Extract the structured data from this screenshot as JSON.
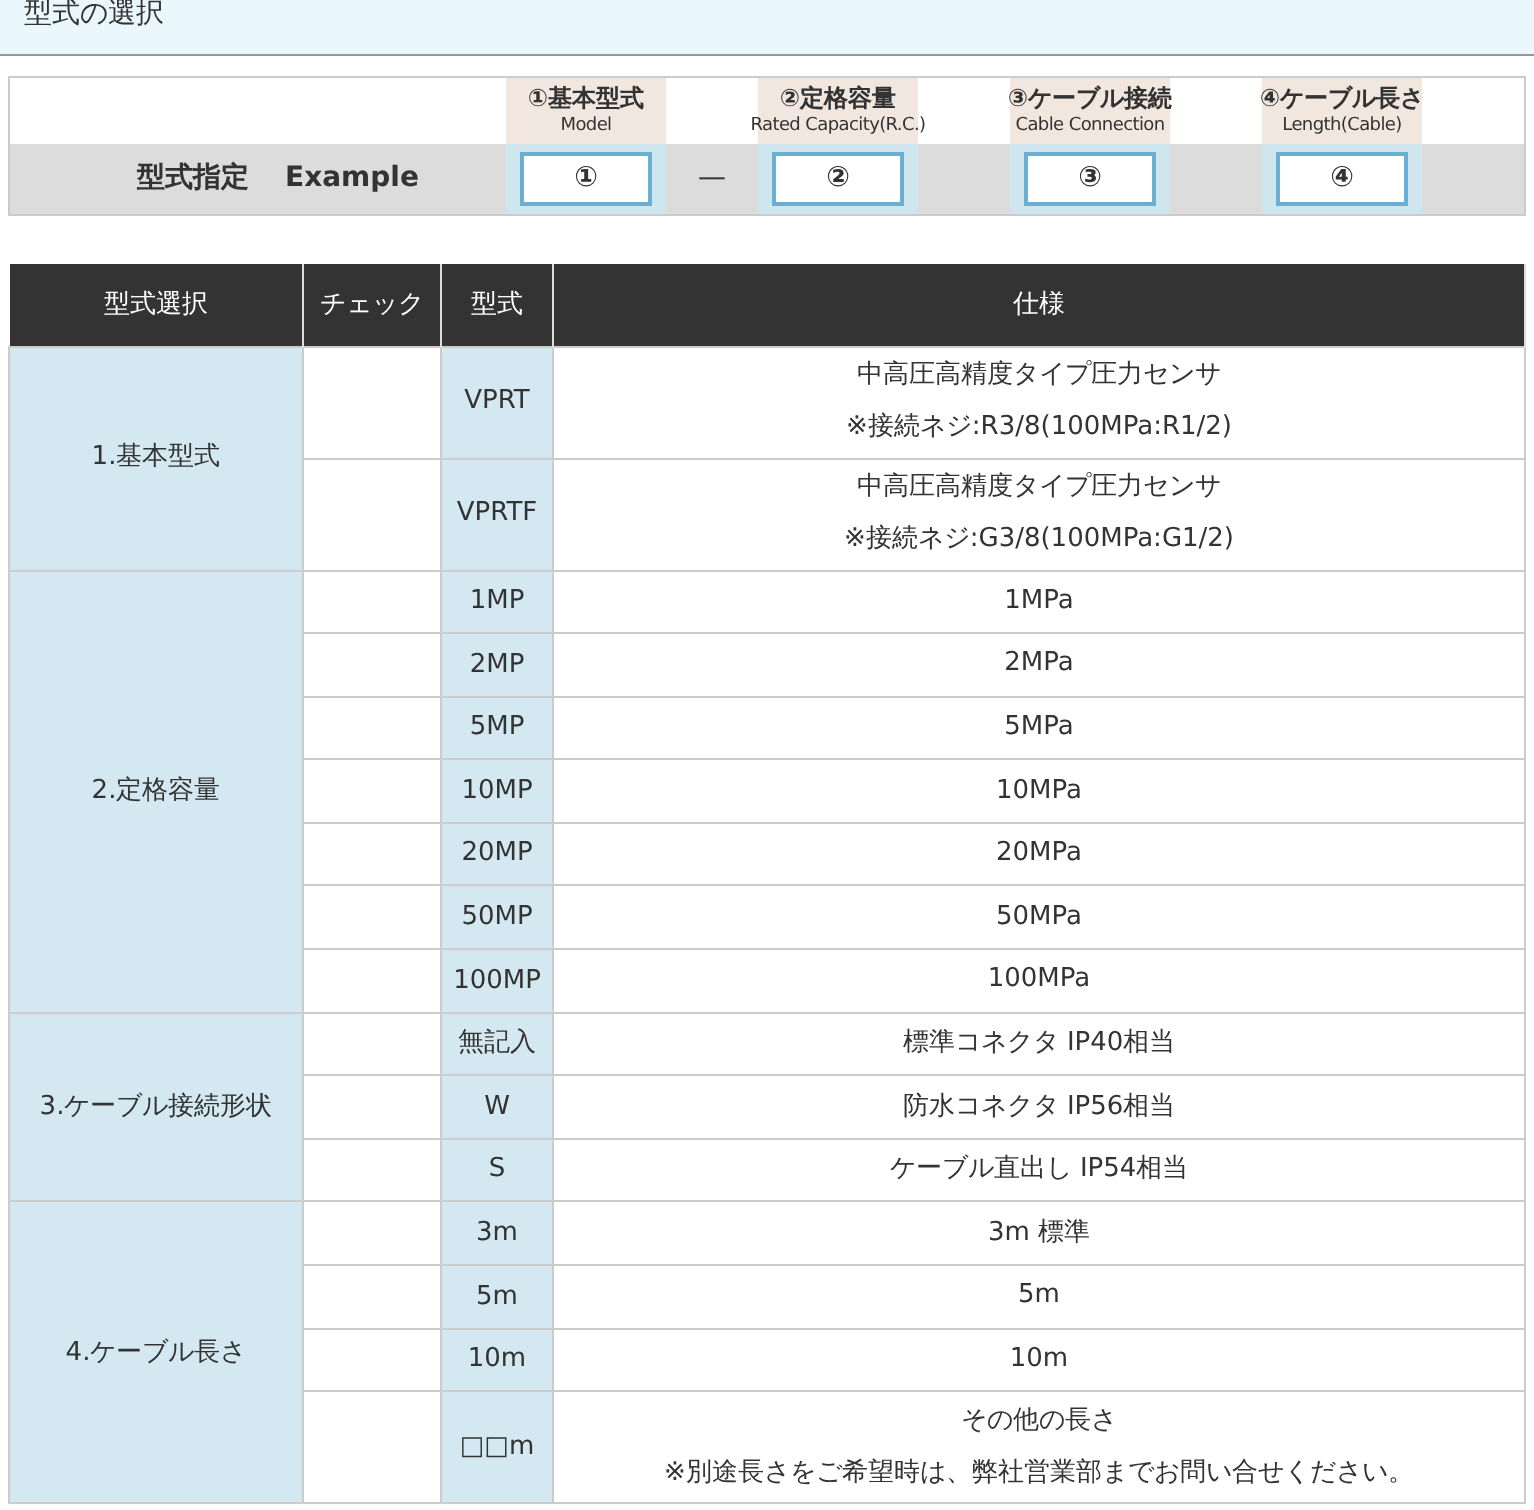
{
  "heading": "型式の選択",
  "example": {
    "label": "型式指定",
    "label_en": "Example",
    "items": [
      {
        "title": "①基本型式",
        "subtitle": "Model",
        "value": "①",
        "separator": "—"
      },
      {
        "title": "②定格容量",
        "subtitle": "Rated Capacity(R.C.)",
        "value": "②"
      },
      {
        "title": "③ケーブル接続",
        "subtitle": "Cable Connection",
        "value": "③"
      },
      {
        "title": "④ケーブル長さ",
        "subtitle": "Length(Cable)",
        "value": "④"
      }
    ]
  },
  "table": {
    "columns": [
      "型式選択",
      "チェック",
      "型式",
      "仕様"
    ],
    "groups": [
      {
        "label": "1.基本型式",
        "options": [
          {
            "model": "VPRT",
            "spec": [
              "中高圧高精度タイプ圧力センサ",
              "※接続ネジ:R3/8(100MPa:R1/2)"
            ]
          },
          {
            "model": "VPRTF",
            "spec": [
              "中高圧高精度タイプ圧力センサ",
              "※接続ネジ:G3/8(100MPa:G1/2)"
            ]
          }
        ]
      },
      {
        "label": "2.定格容量",
        "options": [
          {
            "model": "1MP",
            "spec": [
              "1MPa"
            ]
          },
          {
            "model": "2MP",
            "spec": [
              "2MPa"
            ]
          },
          {
            "model": "5MP",
            "spec": [
              "5MPa"
            ]
          },
          {
            "model": "10MP",
            "spec": [
              "10MPa"
            ]
          },
          {
            "model": "20MP",
            "spec": [
              "20MPa"
            ]
          },
          {
            "model": "50MP",
            "spec": [
              "50MPa"
            ]
          },
          {
            "model": "100MP",
            "spec": [
              "100MPa"
            ]
          }
        ]
      },
      {
        "label": "3.ケーブル接続形状",
        "options": [
          {
            "model": "無記入",
            "spec": [
              "標準コネクタ IP40相当"
            ]
          },
          {
            "model": "W",
            "spec": [
              "防水コネクタ IP56相当"
            ]
          },
          {
            "model": "S",
            "spec": [
              "ケーブル直出し IP54相当"
            ]
          }
        ]
      },
      {
        "label": "4.ケーブル長さ",
        "options": [
          {
            "model": "3m",
            "spec": [
              "3m 標準"
            ]
          },
          {
            "model": "5m",
            "spec": [
              "5m"
            ]
          },
          {
            "model": "10m",
            "spec": [
              "10m"
            ]
          },
          {
            "model": "□□m",
            "spec": [
              "その他の長さ",
              "※別途長さをご希望時は、弊社営業部までお問い合せください。"
            ]
          }
        ]
      }
    ]
  }
}
